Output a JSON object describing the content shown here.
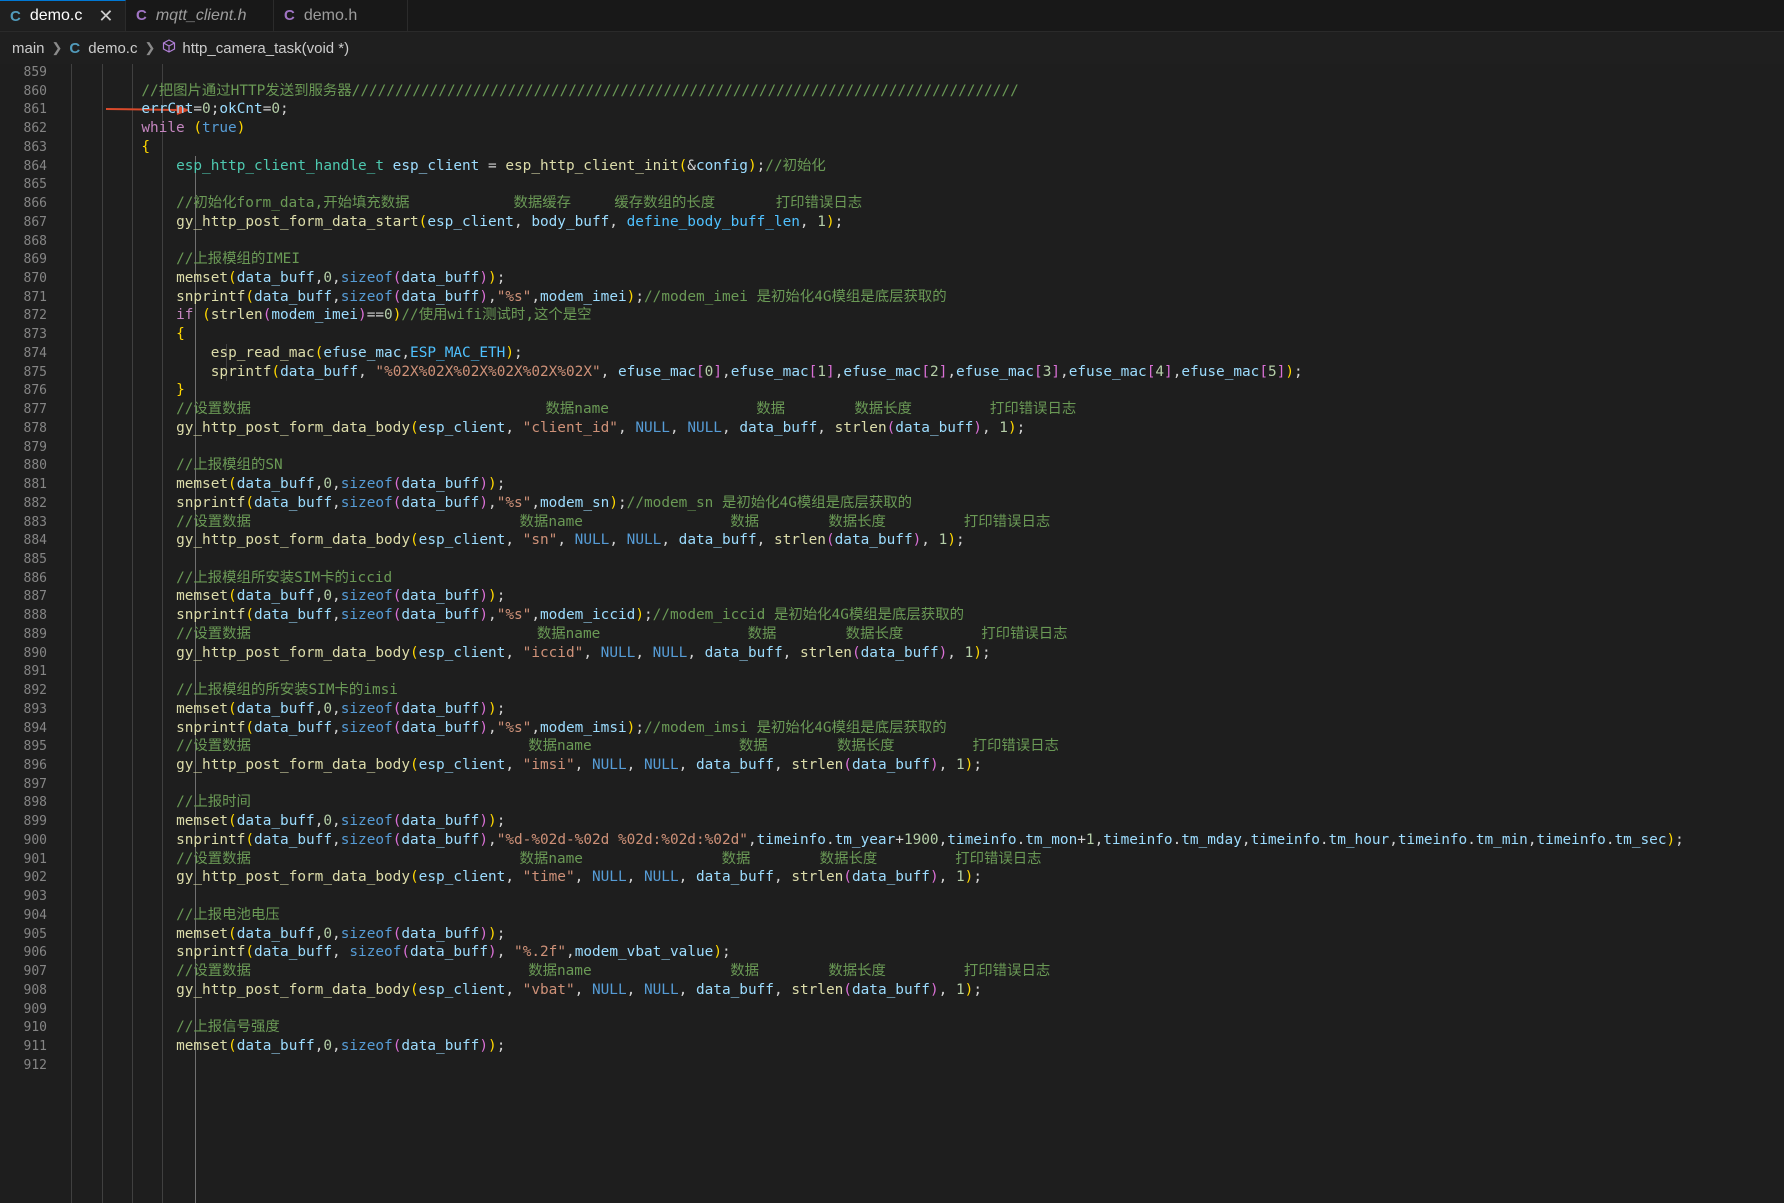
{
  "tabs": [
    {
      "label": "demo.c",
      "active": true,
      "icon": "c-file-icon",
      "icon_color": "#519aba"
    },
    {
      "label": "mqtt_client.h",
      "active": false,
      "icon": "c-file-icon",
      "icon_color": "#a074c4"
    },
    {
      "label": "demo.h",
      "active": false,
      "icon": "c-file-icon",
      "icon_color": "#a074c4"
    }
  ],
  "tab_close_glyph": "✕",
  "file_icon_glyph": "C",
  "breadcrumb": {
    "folder": "main",
    "file": "demo.c",
    "symbol": "http_camera_task(void *)"
  },
  "annotation": {
    "type": "red-arrow",
    "points_to_line": "860",
    "color": "#d84a2b"
  },
  "editor": {
    "lines": [
      {
        "n": "859",
        "text": ""
      },
      {
        "n": "860",
        "text": "        //把图片通过HTTP发送到服务器/////////////////////////////////////////////////////////////////////////////"
      },
      {
        "n": "861",
        "text": "        errCnt=0;okCnt=0;"
      },
      {
        "n": "862",
        "text": "        while (true)"
      },
      {
        "n": "863",
        "text": "        {"
      },
      {
        "n": "864",
        "text": "            esp_http_client_handle_t esp_client = esp_http_client_init(&config);//初始化"
      },
      {
        "n": "865",
        "text": ""
      },
      {
        "n": "866",
        "text": "            //初始化form_data,开始填充数据            数据缓存     缓存数组的长度       打印错误日志"
      },
      {
        "n": "867",
        "text": "            gy_http_post_form_data_start(esp_client, body_buff, define_body_buff_len, 1);"
      },
      {
        "n": "868",
        "text": ""
      },
      {
        "n": "869",
        "text": "            //上报模组的IMEI"
      },
      {
        "n": "870",
        "text": "            memset(data_buff,0,sizeof(data_buff));"
      },
      {
        "n": "871",
        "text": "            snprintf(data_buff,sizeof(data_buff),\"%s\",modem_imei);//modem_imei 是初始化4G模组是底层获取的"
      },
      {
        "n": "872",
        "text": "            if (strlen(modem_imei)==0)//使用wifi测试时,这个是空"
      },
      {
        "n": "873",
        "text": "            {"
      },
      {
        "n": "874",
        "text": "                esp_read_mac(efuse_mac,ESP_MAC_ETH);"
      },
      {
        "n": "875",
        "text": "                sprintf(data_buff, \"%02X%02X%02X%02X%02X%02X\", efuse_mac[0],efuse_mac[1],efuse_mac[2],efuse_mac[3],efuse_mac[4],efuse_mac[5]);"
      },
      {
        "n": "876",
        "text": "            }"
      },
      {
        "n": "877",
        "text": "            //设置数据                                  数据name                 数据        数据长度         打印错误日志"
      },
      {
        "n": "878",
        "text": "            gy_http_post_form_data_body(esp_client, \"client_id\", NULL, NULL, data_buff, strlen(data_buff), 1);"
      },
      {
        "n": "879",
        "text": ""
      },
      {
        "n": "880",
        "text": "            //上报模组的SN"
      },
      {
        "n": "881",
        "text": "            memset(data_buff,0,sizeof(data_buff));"
      },
      {
        "n": "882",
        "text": "            snprintf(data_buff,sizeof(data_buff),\"%s\",modem_sn);//modem_sn 是初始化4G模组是底层获取的"
      },
      {
        "n": "883",
        "text": "            //设置数据                               数据name                 数据        数据长度         打印错误日志"
      },
      {
        "n": "884",
        "text": "            gy_http_post_form_data_body(esp_client, \"sn\", NULL, NULL, data_buff, strlen(data_buff), 1);"
      },
      {
        "n": "885",
        "text": ""
      },
      {
        "n": "886",
        "text": "            //上报模组所安装SIM卡的iccid"
      },
      {
        "n": "887",
        "text": "            memset(data_buff,0,sizeof(data_buff));"
      },
      {
        "n": "888",
        "text": "            snprintf(data_buff,sizeof(data_buff),\"%s\",modem_iccid);//modem_iccid 是初始化4G模组是底层获取的"
      },
      {
        "n": "889",
        "text": "            //设置数据                                 数据name                 数据        数据长度         打印错误日志"
      },
      {
        "n": "890",
        "text": "            gy_http_post_form_data_body(esp_client, \"iccid\", NULL, NULL, data_buff, strlen(data_buff), 1);"
      },
      {
        "n": "891",
        "text": ""
      },
      {
        "n": "892",
        "text": "            //上报模组的所安装SIM卡的imsi"
      },
      {
        "n": "893",
        "text": "            memset(data_buff,0,sizeof(data_buff));"
      },
      {
        "n": "894",
        "text": "            snprintf(data_buff,sizeof(data_buff),\"%s\",modem_imsi);//modem_imsi 是初始化4G模组是底层获取的"
      },
      {
        "n": "895",
        "text": "            //设置数据                                数据name                 数据        数据长度         打印错误日志"
      },
      {
        "n": "896",
        "text": "            gy_http_post_form_data_body(esp_client, \"imsi\", NULL, NULL, data_buff, strlen(data_buff), 1);"
      },
      {
        "n": "897",
        "text": ""
      },
      {
        "n": "898",
        "text": "            //上报时间"
      },
      {
        "n": "899",
        "text": "            memset(data_buff,0,sizeof(data_buff));"
      },
      {
        "n": "900",
        "text": "            snprintf(data_buff,sizeof(data_buff),\"%d-%02d-%02d %02d:%02d:%02d\",timeinfo.tm_year+1900,timeinfo.tm_mon+1,timeinfo.tm_mday,timeinfo.tm_hour,timeinfo.tm_min,timeinfo.tm_sec);"
      },
      {
        "n": "901",
        "text": "            //设置数据                               数据name                数据        数据长度         打印错误日志"
      },
      {
        "n": "902",
        "text": "            gy_http_post_form_data_body(esp_client, \"time\", NULL, NULL, data_buff, strlen(data_buff), 1);"
      },
      {
        "n": "903",
        "text": ""
      },
      {
        "n": "904",
        "text": "            //上报电池电压"
      },
      {
        "n": "905",
        "text": "            memset(data_buff,0,sizeof(data_buff));"
      },
      {
        "n": "906",
        "text": "            snprintf(data_buff, sizeof(data_buff), \"%.2f\",modem_vbat_value);"
      },
      {
        "n": "907",
        "text": "            //设置数据                                数据name                数据        数据长度         打印错误日志"
      },
      {
        "n": "908",
        "text": "            gy_http_post_form_data_body(esp_client, \"vbat\", NULL, NULL, data_buff, strlen(data_buff), 1);"
      },
      {
        "n": "909",
        "text": ""
      },
      {
        "n": "910",
        "text": "            //上报信号强度"
      },
      {
        "n": "911",
        "text": "            memset(data_buff,0,sizeof(data_buff));"
      },
      {
        "n": "912",
        "text": ""
      }
    ]
  }
}
